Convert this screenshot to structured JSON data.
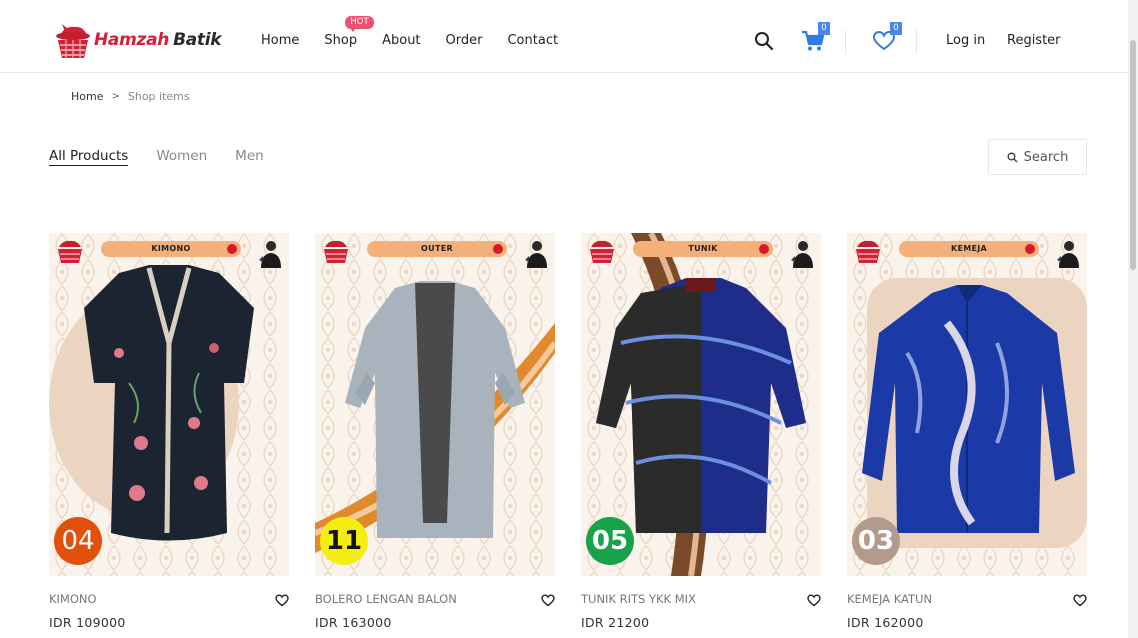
{
  "brand": {
    "name_part1": "Hamzah",
    "name_part2": "Batik"
  },
  "nav": [
    {
      "label": "Home"
    },
    {
      "label": "Shop",
      "badge": "HOT"
    },
    {
      "label": "About"
    },
    {
      "label": "Order"
    },
    {
      "label": "Contact"
    }
  ],
  "header_icons": {
    "search": "search-icon",
    "cart": "cart-icon",
    "wishlist": "heart-icon"
  },
  "counts": {
    "cart": "0",
    "wishlist": "0"
  },
  "auth": {
    "login": "Log in",
    "register": "Register"
  },
  "breadcrumb": {
    "home": "Home",
    "separator": ">",
    "current": "Shop items"
  },
  "filters": [
    {
      "label": "All Products",
      "active": true
    },
    {
      "label": "Women",
      "active": false
    },
    {
      "label": "Men",
      "active": false
    }
  ],
  "search": {
    "label": "Search"
  },
  "colors": {
    "brand_red": "#d61f36",
    "hot_badge": "#f0506e",
    "count_badge": "#4b87ea",
    "card_background": "#f4e3d3"
  },
  "products": [
    {
      "name": "KIMONO",
      "price": "IDR 109000",
      "category": "KIMONO",
      "number": "04",
      "number_bg": "#e1510b",
      "number_color": "#ffffff"
    },
    {
      "name": "BOLERO LENGAN BALON",
      "price": "IDR 163000",
      "category": "OUTER",
      "number": "11",
      "number_bg": "#f4ee10",
      "number_color": "#111111"
    },
    {
      "name": "TUNIK RITS YKK MIX",
      "price": "IDR 21200",
      "category": "TUNIK",
      "number": "05",
      "number_bg": "#18a24a",
      "number_color": "#ffffff"
    },
    {
      "name": "KEMEJA KATUN",
      "price": "IDR 162000",
      "category": "KEMEJA",
      "number": "03",
      "number_bg": "#b39a8c",
      "number_color": "#ffffff"
    }
  ]
}
